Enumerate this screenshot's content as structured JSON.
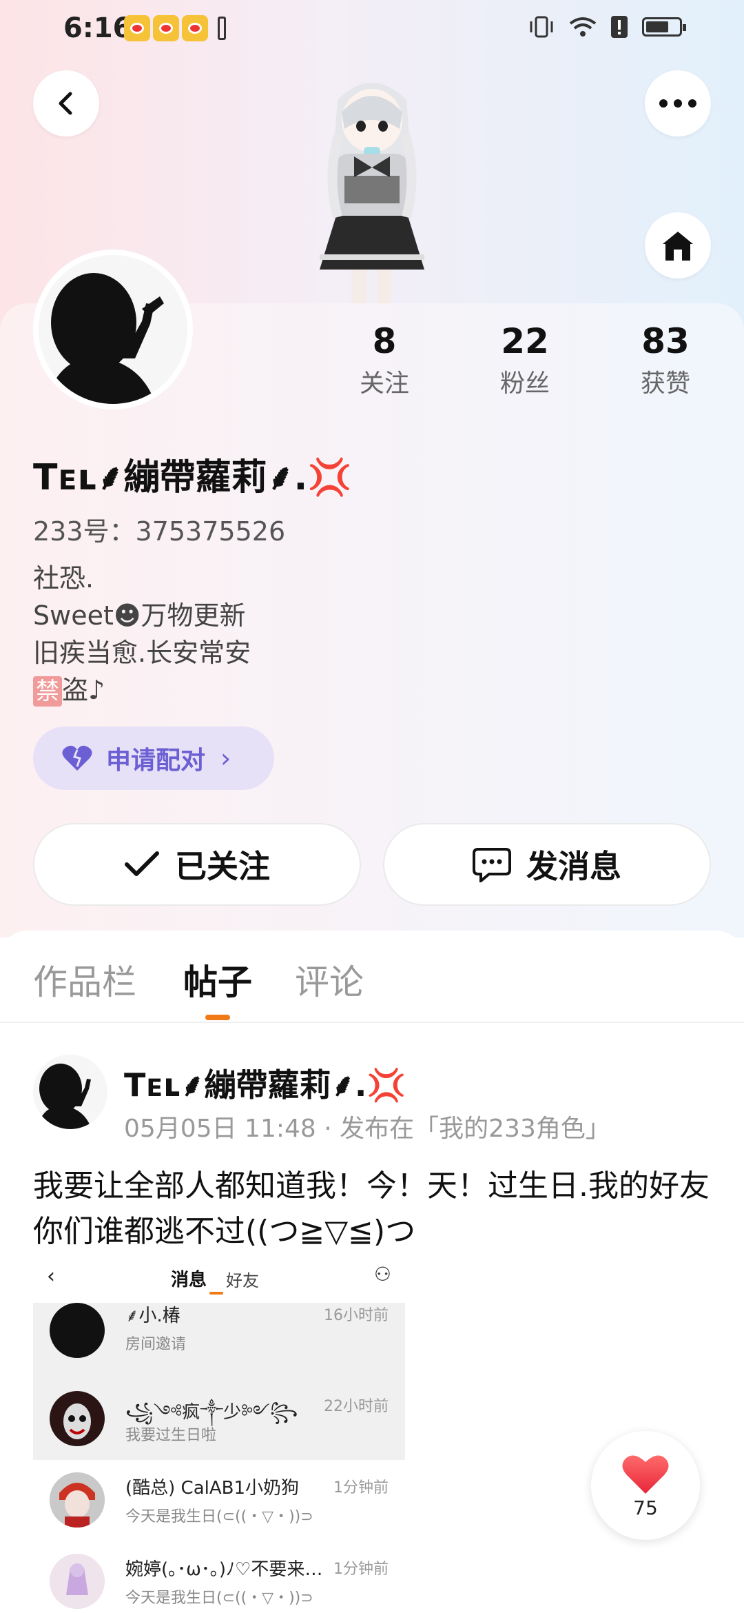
{
  "status_bar": {
    "time": "6:16"
  },
  "profile": {
    "username": "Tᴇʟ⸙繃帶蘿莉⸙.💢",
    "id_label": "233号：375375526",
    "bio": [
      "社恐.",
      "Sweet☻万物更新",
      "旧疾当愈.长安常安"
    ],
    "bio_badge": "禁",
    "bio_last": "盗♪",
    "stats": [
      {
        "num": "8",
        "label": "关注"
      },
      {
        "num": "22",
        "label": "粉丝"
      },
      {
        "num": "83",
        "label": "获赞"
      }
    ],
    "pair_label": "申请配对",
    "follow_label": "已关注",
    "message_label": "发消息"
  },
  "tabs": [
    "作品栏",
    "帖子",
    "评论"
  ],
  "post": {
    "author": "Tᴇʟ⸙繃帶蘿莉⸙.💢",
    "meta": "05月05日 11:48 · 发布在「我的233角色」",
    "text": "我要让全部人都知道我！今！天！过生日.我的好友你们谁都逃不过((つ≧▽≦)つ",
    "screenshot": {
      "tab_active": "消息",
      "tab_other": "好友",
      "rows": [
        {
          "name": "⸙小.椿",
          "msg": "房间邀请",
          "time": "16小时前"
        },
        {
          "name": "꧁༺疯༒少༻꧂",
          "msg": "我要过生日啦",
          "time": "22小时前"
        },
        {
          "name": "(酷总) CalAB1小奶狗",
          "msg": "今天是我生日(⊂((・▽・))⊃",
          "time": "1分钟前"
        },
        {
          "name": "婉婷(｡･ω･｡)ﾉ♡不要来…",
          "msg": "今天是我生日(⊂((・▽・))⊃",
          "time": "1分钟前"
        }
      ]
    }
  },
  "like": {
    "count": "75"
  },
  "colors": {
    "accent": "#f07a18",
    "pair": "#6b5fd3",
    "heart": "#f2404b"
  }
}
